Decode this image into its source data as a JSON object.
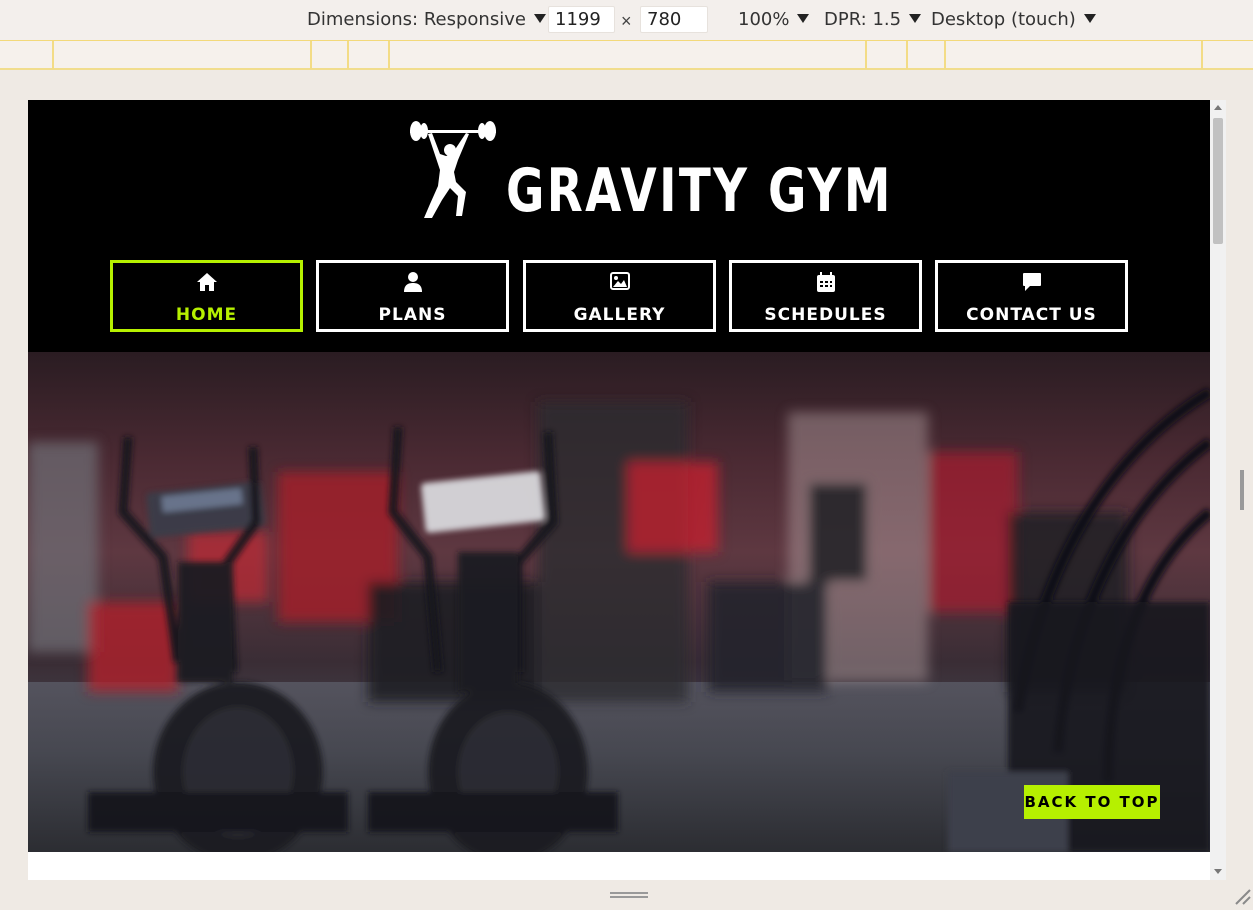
{
  "devtools": {
    "dimensions_label": "Dimensions: Responsive",
    "width": "1199",
    "height": "780",
    "times_sign": "×",
    "zoom": "100%",
    "dpr": "DPR: 1.5",
    "device_mode": "Desktop (touch)"
  },
  "site": {
    "brand": "GRAVITY GYM",
    "accent_color": "#b6f000",
    "nav": [
      {
        "label": "HOME",
        "icon": "home-icon",
        "active": true
      },
      {
        "label": "PLANS",
        "icon": "user-icon",
        "active": false
      },
      {
        "label": "GALLERY",
        "icon": "image-icon",
        "active": false
      },
      {
        "label": "SCHEDULES",
        "icon": "calendar-icon",
        "active": false
      },
      {
        "label": "CONTACT US",
        "icon": "chat-icon",
        "active": false
      }
    ],
    "back_to_top": "BACK TO TOP"
  }
}
